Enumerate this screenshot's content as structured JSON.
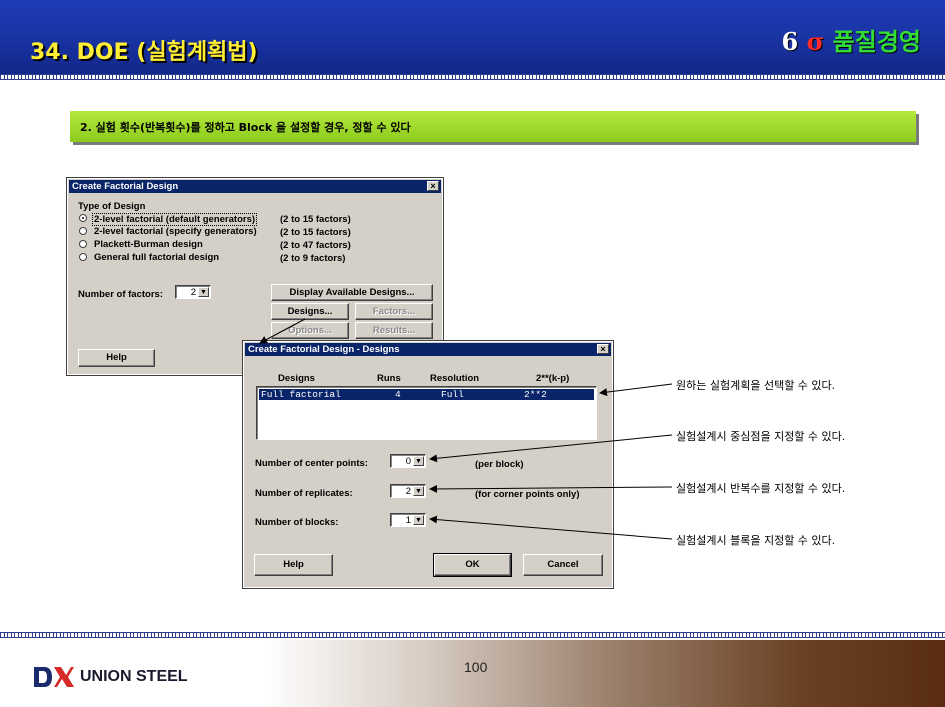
{
  "header": {
    "title": "34. DOE (실험계획법)",
    "brand_six": "6",
    "brand_sigma": "σ",
    "brand_text": "품질경영"
  },
  "banner": {
    "text": "2. 실험 횟수(반복횟수)를 정하고 Block 을 설정할 경우, 정할 수 있다"
  },
  "dialog1": {
    "title": "Create Factorial Design",
    "close": "×",
    "type_label": "Type of Design",
    "options": [
      {
        "label": "2-level factorial (default generators)",
        "range": "(2 to 15 factors)"
      },
      {
        "label": "2-level factorial (specify generators)",
        "range": "(2 to 15 factors)"
      },
      {
        "label": "Plackett-Burman design",
        "range": "(2 to 47 factors)"
      },
      {
        "label": "General full factorial design",
        "range": "(2 to 9 factors)"
      }
    ],
    "num_factors_label": "Number of factors:",
    "num_factors_value": "2",
    "display_btn": "Display Available Designs...",
    "designs_btn": "Designs...",
    "factors_btn": "Factors...",
    "options_btn": "Options...",
    "results_btn": "Results...",
    "help_btn": "Help"
  },
  "dialog2": {
    "title": "Create Factorial Design - Designs",
    "close": "×",
    "col_designs": "Designs",
    "col_runs": "Runs",
    "col_resolution": "Resolution",
    "col_kp": "2**(k-p)",
    "row": {
      "design": "Full factorial",
      "runs": "4",
      "resolution": "Full",
      "kp": "2**2"
    },
    "center_label": "Number of center points:",
    "center_value": "0",
    "center_note": "(per block)",
    "replicates_label": "Number of replicates:",
    "replicates_value": "2",
    "replicates_note": "(for corner points only)",
    "blocks_label": "Number of blocks:",
    "blocks_value": "1",
    "help_btn": "Help",
    "ok_btn": "OK",
    "cancel_btn": "Cancel"
  },
  "annotations": [
    "원하는 실험계획을 선택할 수 있다.",
    "실험설계시 중심점을 지정할 수 있다.",
    "실험설계시 반복수를 지정할 수 있다.",
    "실험설계시 블록을 지정할 수 있다."
  ],
  "footer": {
    "logo_text": "UNION STEEL",
    "page_number": "100"
  }
}
